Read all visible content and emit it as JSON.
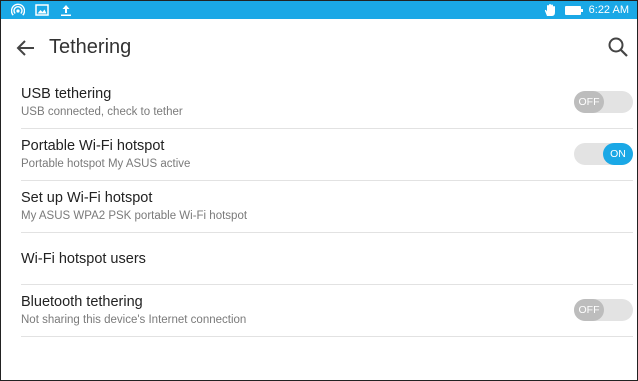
{
  "status_bar": {
    "time": "6:22 AM",
    "left_icons": [
      "hotspot-icon",
      "image-icon",
      "upload-icon"
    ],
    "right_icons": [
      "hand-icon",
      "battery-icon"
    ],
    "color": "#1aa8e6"
  },
  "app_bar": {
    "title": "Tethering",
    "back_icon": "arrow-left-icon",
    "search_icon": "search-icon"
  },
  "settings": [
    {
      "title": "USB tethering",
      "subtitle": "USB connected, check to tether",
      "toggle": "OFF"
    },
    {
      "title": "Portable Wi-Fi hotspot",
      "subtitle": "Portable hotspot My ASUS active",
      "toggle": "ON"
    },
    {
      "title": "Set up Wi-Fi hotspot",
      "subtitle": "My ASUS WPA2 PSK portable Wi-Fi hotspot"
    },
    {
      "title": "Wi-Fi hotspot users"
    },
    {
      "title": "Bluetooth tethering",
      "subtitle": "Not sharing this device's Internet connection",
      "toggle": "OFF"
    }
  ],
  "colors": {
    "accent": "#1aa8e6",
    "toggle_off": "#bdbdbd"
  }
}
